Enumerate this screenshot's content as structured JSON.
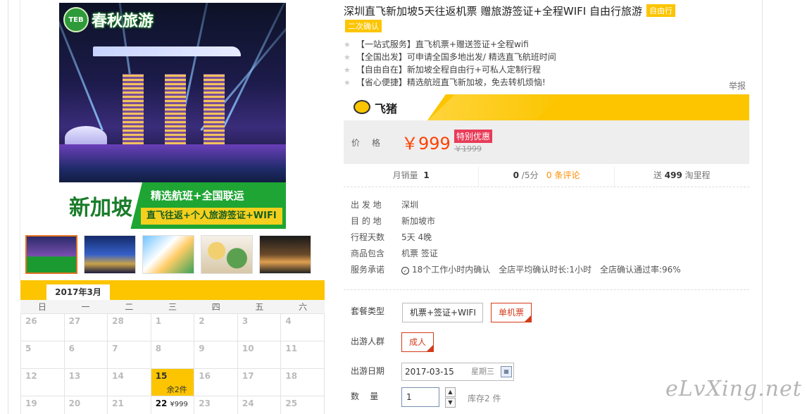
{
  "product": {
    "title": "深圳直飞新加坡5天往返机票 赠旅游签证+全程WIFI 自由行旅游",
    "type_badge": "自由行",
    "confirm_badge": "二次确认",
    "features": [
      "【一站式服务】直飞机票+赠送签证+全程wifi",
      "【全国出发】可申请全国多地出发/ 精选直飞航班时间",
      "【自由自在】新加坡全程自由行+可私人定制行程",
      "【省心便捷】精选航班直飞新加坡，免去转机烦恼!"
    ],
    "report_label": "举报"
  },
  "image": {
    "logo_mark": "TEB",
    "logo_text": "春秋旅游",
    "banner_city": "新加坡",
    "banner_line1": "精选航班+全国联运",
    "banner_line2": "直飞往返+个人旅游签证+WIFI"
  },
  "brand": {
    "name": "飞猪",
    "color": "#fcc500"
  },
  "price": {
    "label": "价格",
    "value": "￥999",
    "promo_tag": "特别优惠",
    "original": "￥1999",
    "color": "#ff4200"
  },
  "stats": {
    "monthly_sales_label": "月销量",
    "monthly_sales_value": "1",
    "rating_value": "0",
    "rating_unit": "/5分",
    "reviews": "0 条评论",
    "points_prefix": "送",
    "points_value": "499",
    "points_suffix": "淘里程"
  },
  "info": [
    {
      "label": "出 发 地",
      "value": "深圳"
    },
    {
      "label": "目 的 地",
      "value": "新加坡市"
    },
    {
      "label": "行程天数",
      "value": "5天 4晚"
    },
    {
      "label": "商品包含",
      "value": "机票  签证"
    }
  ],
  "service": {
    "label": "服务承诺",
    "items": [
      "18个工作小时内确认",
      "全店平均确认时长:1小时",
      "全店确认通过率:96%"
    ]
  },
  "options": {
    "package_label": "套餐类型",
    "package_choices": [
      "机票+签证+WIFI",
      "单机票"
    ],
    "crowd_label": "出游人群",
    "crowd_choice": "成人",
    "date_label": "出游日期",
    "date_value": "2017-03-15",
    "date_weekday": "星期三",
    "qty_label": "数    量",
    "qty_value": "1",
    "stock": "库存2 件"
  },
  "calendar": {
    "month": "2017年3月",
    "weekdays": [
      "日",
      "一",
      "二",
      "三",
      "四",
      "五",
      "六"
    ],
    "weeks": [
      [
        "26",
        "27",
        "28",
        "1",
        "2",
        "3",
        "4"
      ],
      [
        "5",
        "6",
        "7",
        "8",
        "9",
        "10",
        "11"
      ],
      [
        "12",
        "13",
        "14",
        "15",
        "16",
        "17",
        "18"
      ],
      [
        "19",
        "20",
        "21",
        "22",
        "23",
        "24",
        "25"
      ]
    ],
    "selected_note": "余2件",
    "price_22": "¥999"
  },
  "watermark": "eLvXing.net"
}
